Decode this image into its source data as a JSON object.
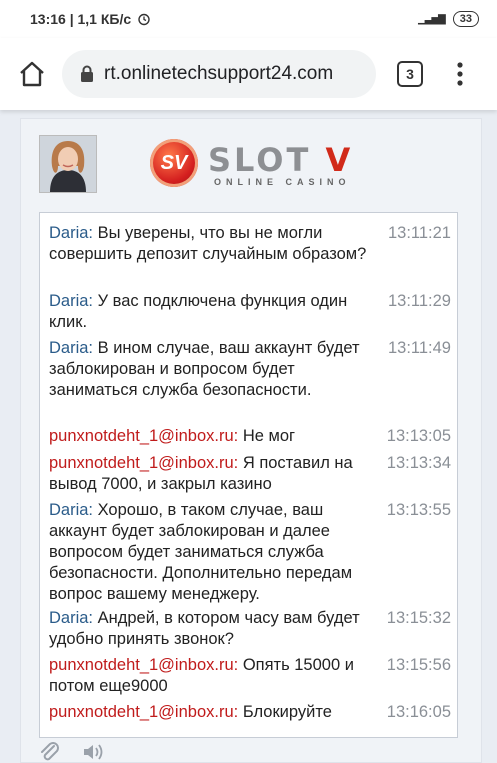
{
  "status_bar": {
    "time_and_speed": "13:16 | 1,1 КБ/с",
    "battery": "33"
  },
  "browser": {
    "url": "rt.onlinetechsupport24.com",
    "tab_count": "3"
  },
  "logo": {
    "badge": "SV",
    "brand_main": "SLOT",
    "brand_v": "V",
    "tagline": "ONLINE CASINO"
  },
  "messages": [
    {
      "sender": "Daria:",
      "text": "Вы уверены, что вы не могли совершить депозит случайным образом?",
      "time": "13:11:21",
      "role": "agent"
    },
    {
      "sender": "Daria:",
      "text": "У вас подключена функция один клик.",
      "time": "13:11:29",
      "role": "agent"
    },
    {
      "sender": "Daria:",
      "text": "В ином случае, ваш аккаунт будет заблокирован и вопросом будет заниматься служба безопасности.",
      "time": "13:11:49",
      "role": "agent"
    },
    {
      "sender": "punxnotdeht_1@inbox.ru:",
      "text": "Не мог",
      "time": "13:13:05",
      "role": "user"
    },
    {
      "sender": "punxnotdeht_1@inbox.ru:",
      "text": "Я поставил на вывод 7000, и закрыл казино",
      "time": "13:13:34",
      "role": "user"
    },
    {
      "sender": "Daria:",
      "text": "Хорошо, в таком случае, ваш аккаунт будет заблокирован и далее вопросом будет заниматься служба безопасности. Дополнительно передам вопрос вашему менеджеру.",
      "time": "13:13:55",
      "role": "agent"
    },
    {
      "sender": "Daria:",
      "text": "Андрей, в котором часу вам будет удобно принять звонок?",
      "time": "13:15:32",
      "role": "agent"
    },
    {
      "sender": "punxnotdeht_1@inbox.ru:",
      "text": "Опять 15000 и потом еще9000",
      "time": "13:15:56",
      "role": "user"
    },
    {
      "sender": "punxnotdeht_1@inbox.ru:",
      "text": "Блокируйте",
      "time": "13:16:05",
      "role": "user"
    }
  ]
}
